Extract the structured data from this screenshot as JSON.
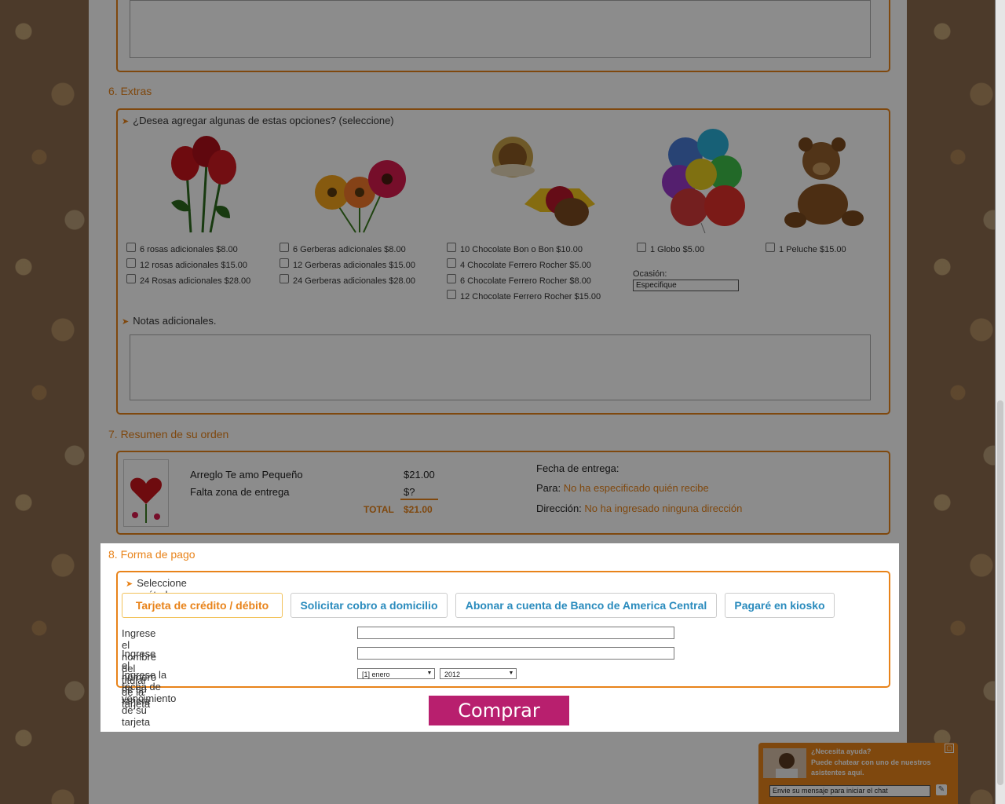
{
  "extras": {
    "title": "6. Extras",
    "prompt": "¿Desea agregar algunas de estas opciones? (seleccione)",
    "roses": [
      "6 rosas adicionales $8.00",
      "12 rosas adicionales $15.00",
      "24 Rosas adicionales $28.00"
    ],
    "gerberas": [
      "6 Gerberas adicionales $8.00",
      "12 Gerberas adicionales $15.00",
      "24 Gerberas adicionales $28.00"
    ],
    "chocolates": [
      "10 Chocolate Bon o Bon $10.00",
      "4 Chocolate Ferrero Rocher $5.00",
      "6 Chocolate Ferrero Rocher $8.00",
      "12 Chocolate Ferrero Rocher $15.00"
    ],
    "globo": "1 Globo $5.00",
    "peluche": "1 Peluche $15.00",
    "ocasion_label": "Ocasión:",
    "ocasion_value": "Especifique",
    "notes_label": "Notas adicionales."
  },
  "summary": {
    "title": "7. Resumen de su orden",
    "item_name": "Arreglo Te amo Pequeño",
    "item_price": "$21.00",
    "zone_label": "Falta zona de entrega",
    "zone_price": "$?",
    "total_label": "TOTAL",
    "total_value": "$21.00",
    "fecha_label": "Fecha de entrega:",
    "para_label": "Para:",
    "para_value": "No ha especificado quién recibe",
    "direccion_label": "Dirección:",
    "direccion_value": "No ha ingresado ninguna dirección"
  },
  "payment": {
    "title": "8. Forma de pago",
    "prompt": "Seleccione su método de pago",
    "methods": [
      "Tarjeta de crédito / débito",
      "Solicitar cobro a domicilio",
      "Abonar a cuenta de Banco de America Central",
      "Pagaré en kiosko"
    ],
    "holder_label": "Ingrese el nombre del titular de la tarjeta",
    "number_label": "Ingrese el número de su tarjeta",
    "expiry_label": "Ingrese la fecha de vencimiento de su tarjeta",
    "month_value": "[1] enero",
    "year_value": "2012",
    "submit_label": "Comprar"
  },
  "chat": {
    "title": "¿Necesita ayuda?",
    "text": "Puede chatear con uno de nuestros asistentes aquí.",
    "placeholder": "Envie su mensaje para iniciar el chat"
  },
  "colors": {
    "accent": "#e8831a",
    "link": "#2a8bbd",
    "buy": "#b81f6e"
  }
}
